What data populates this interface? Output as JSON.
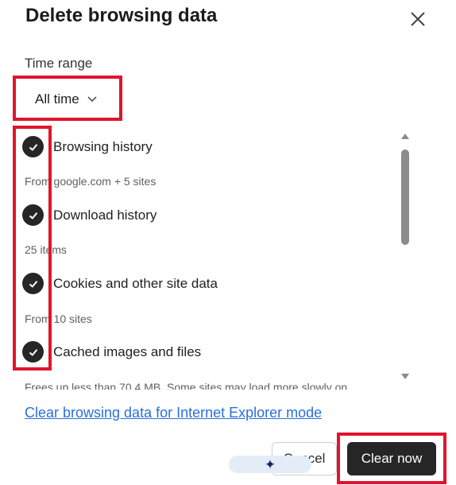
{
  "dialog": {
    "title": "Delete browsing data",
    "close_icon": "close-icon"
  },
  "time_range": {
    "label": "Time range",
    "selected": "All time",
    "icon": "chevron-down-icon"
  },
  "items": [
    {
      "label": "Browsing history",
      "description": "From google.com + 5 sites",
      "checked": true
    },
    {
      "label": "Download history",
      "description": "25 items",
      "checked": true
    },
    {
      "label": "Cookies and other site data",
      "description": "From 10 sites",
      "checked": true
    },
    {
      "label": "Cached images and files",
      "description": "Frees up less than 70.4 MB. Some sites may load more slowly on",
      "checked": true
    }
  ],
  "links": {
    "ie_mode": "Clear browsing data for Internet Explorer mode"
  },
  "buttons": {
    "cancel": "Cancel",
    "clear": "Clear now"
  },
  "colors": {
    "highlight": "#e0142c",
    "primary_button": "#262626",
    "link": "#2a6fdb",
    "check": "#262626"
  }
}
